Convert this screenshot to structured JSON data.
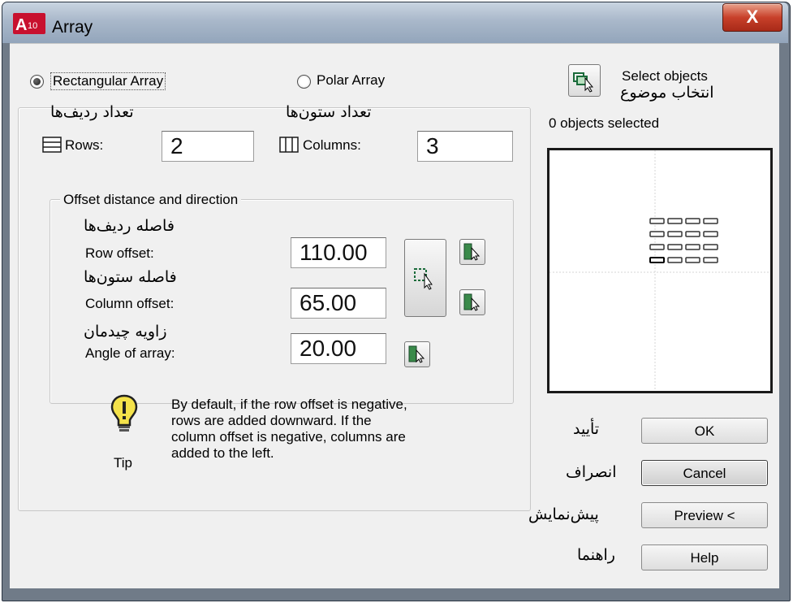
{
  "window": {
    "title": "Array",
    "close_label": "X",
    "app_icon": "autocad-a10-icon"
  },
  "array_type": {
    "rectangular_label": "Rectangular Array",
    "polar_label": "Polar Array",
    "selected": "rectangular"
  },
  "select_objects": {
    "label": "Select objects",
    "label_fa": "انتخاب موضوع",
    "status": "0 objects selected"
  },
  "rows": {
    "label": "Rows:",
    "label_fa": "تعداد ردیف‌ها",
    "value": "2"
  },
  "columns": {
    "label": "Columns:",
    "label_fa": "تعداد ستون‌ها",
    "value": "3"
  },
  "offset_group": {
    "title": "Offset distance and direction",
    "row_offset": {
      "label": "Row offset:",
      "label_fa": "فاصله ردیف‌ها",
      "value": "110.00"
    },
    "column_offset": {
      "label": "Column offset:",
      "label_fa": "فاصله ستون‌ها",
      "value": "65.00"
    },
    "angle": {
      "label": "Angle of array:",
      "label_fa": "زاویه چیدمان",
      "value": "20.00"
    }
  },
  "tip": {
    "label": "Tip",
    "lines": [
      "By default, if the row offset is negative,",
      "rows are added downward.  If the",
      "column offset is negative, columns are",
      "added to the left."
    ]
  },
  "buttons": {
    "ok": {
      "label": "OK",
      "label_fa": "تأیید"
    },
    "cancel": {
      "label": "Cancel",
      "label_fa": "انصراف"
    },
    "preview": {
      "label": "Preview <",
      "label_fa": "پیش‌نمایش"
    },
    "help": {
      "label": "Help",
      "label_fa": "راهنما"
    }
  },
  "colors": {
    "titlebar": "#a9b8ca",
    "close": "#c8402a",
    "dialog_bg": "#f0f0f0",
    "frame": "#707b88"
  }
}
